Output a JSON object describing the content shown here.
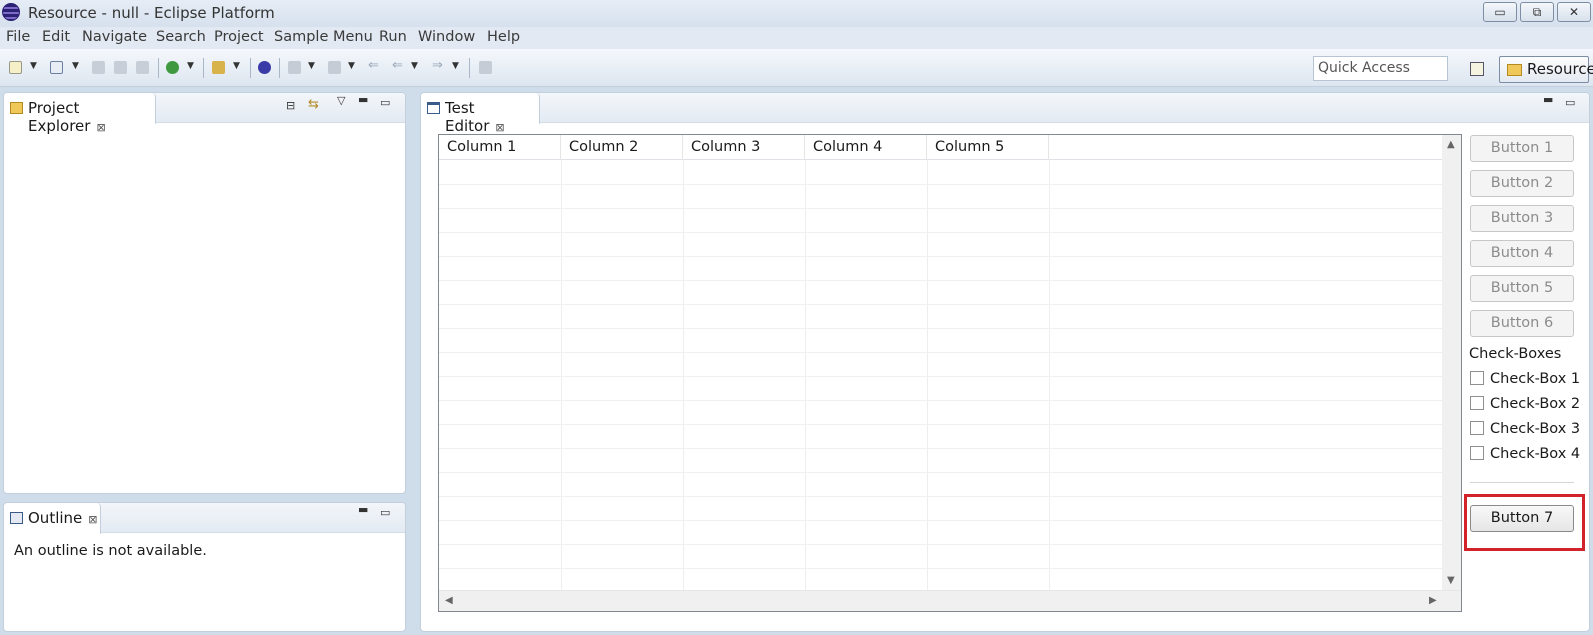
{
  "window": {
    "title": "Resource - null - Eclipse Platform",
    "minimize_label": "▭",
    "restore_label": "⧉",
    "close_label": "✕"
  },
  "menu": [
    "File",
    "Edit",
    "Navigate",
    "Search",
    "Project",
    "Sample Menu",
    "Run",
    "Window",
    "Help"
  ],
  "toolbar": {
    "quick_access_placeholder": "Quick Access",
    "perspective_label": "Resource"
  },
  "project_explorer": {
    "tab_label": "Project Explorer",
    "close_glyph": "⊠"
  },
  "outline": {
    "tab_label": "Outline",
    "close_glyph": "⊠",
    "message": "An outline is not available."
  },
  "editor": {
    "tab_label": "Test Editor",
    "close_glyph": "⊠",
    "table": {
      "columns": [
        "Column 1",
        "Column 2",
        "Column 3",
        "Column 4",
        "Column 5"
      ],
      "rows": []
    },
    "buttons": [
      "Button 1",
      "Button 2",
      "Button 3",
      "Button 4",
      "Button 5",
      "Button 6"
    ],
    "checkbox_heading": "Check-Boxes",
    "checkboxes": [
      {
        "label": "Check-Box 1",
        "checked": false
      },
      {
        "label": "Check-Box 2",
        "checked": false
      },
      {
        "label": "Check-Box 3",
        "checked": false
      },
      {
        "label": "Check-Box 4",
        "checked": false
      }
    ],
    "button7_label": "Button 7"
  },
  "colors": {
    "highlight": "#d2232a",
    "window_background": "#cfdcea"
  }
}
